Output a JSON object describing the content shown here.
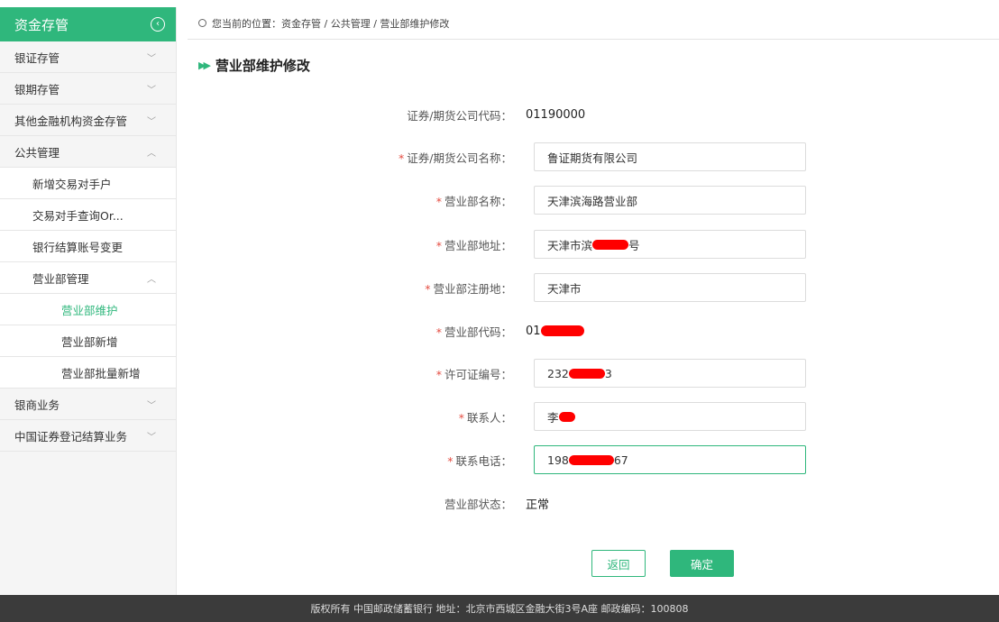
{
  "sidebar": {
    "header": "资金存管",
    "items": [
      {
        "label": "银证存管",
        "chevron": "down"
      },
      {
        "label": "银期存管",
        "chevron": "down"
      },
      {
        "label": "其他金融机构资金存管",
        "chevron": "down"
      },
      {
        "label": "公共管理",
        "chevron": "up"
      },
      {
        "label": "新增交易对手户"
      },
      {
        "label": "交易对手查询Or..."
      },
      {
        "label": "银行结算账号变更"
      },
      {
        "label": "营业部管理",
        "chevron": "up"
      },
      {
        "label": "营业部维护"
      },
      {
        "label": "营业部新增"
      },
      {
        "label": "营业部批量新增"
      },
      {
        "label": "银商业务",
        "chevron": "down"
      },
      {
        "label": "中国证券登记结算业务",
        "chevron": "down"
      }
    ]
  },
  "breadcrumb": "您当前的位置：资金存管 / 公共管理 / 营业部维护修改",
  "page_title": "营业部维护修改",
  "form": {
    "code": {
      "label": "证券/期货公司代码：",
      "value": "01190000"
    },
    "company_name": {
      "label": "证券/期货公司名称：",
      "value": "鲁证期货有限公司"
    },
    "branch_name": {
      "label": "营业部名称：",
      "value": "天津滨海路营业部"
    },
    "branch_address": {
      "label": "营业部地址：",
      "prefix": "天津市滨",
      "suffix": "号"
    },
    "branch_reg": {
      "label": "营业部注册地：",
      "value": "天津市"
    },
    "branch_code": {
      "label": "营业部代码：",
      "prefix": "01"
    },
    "license": {
      "label": "许可证编号：",
      "prefix": "232",
      "suffix": "3"
    },
    "contact": {
      "label": "联系人：",
      "prefix": "李"
    },
    "phone": {
      "label": "联系电话：",
      "prefix": "198",
      "suffix": "67"
    },
    "status": {
      "label": "营业部状态：",
      "value": "正常"
    }
  },
  "buttons": {
    "back": "返回",
    "confirm": "确定"
  },
  "footer": "版权所有 中国邮政储蓄银行 地址：北京市西城区金融大街3号A座 邮政编码：100808",
  "colors": {
    "accent": "#2fb77c",
    "required": "#e54d42",
    "footer_bg": "#3b3b3b"
  },
  "icons": {
    "collapse": "circle-chevron-left-icon",
    "location": "location-pin-icon",
    "title": "double-arrow-icon"
  }
}
